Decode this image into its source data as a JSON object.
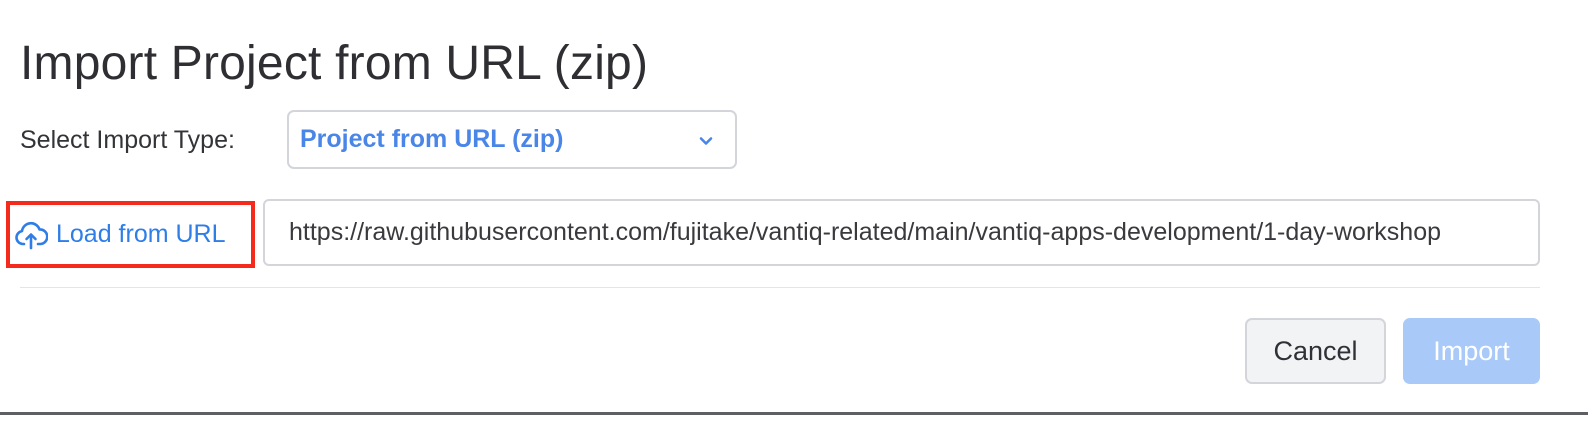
{
  "dialog": {
    "title": "Import Project from URL (zip)"
  },
  "import_type": {
    "label": "Select Import Type:",
    "selected": "Project from URL (zip)"
  },
  "load": {
    "label": "Load from URL",
    "icon": "cloud-upload-icon"
  },
  "url": {
    "value": "https://raw.githubusercontent.com/fujitake/vantiq-related/main/vantiq-apps-development/1-day-workshop"
  },
  "actions": {
    "cancel_label": "Cancel",
    "import_label": "Import"
  },
  "colors": {
    "accent": "#4a86e8",
    "link": "#2f7ee8",
    "highlight_border": "#f42a1c",
    "import_disabled": "#a9caf8"
  }
}
